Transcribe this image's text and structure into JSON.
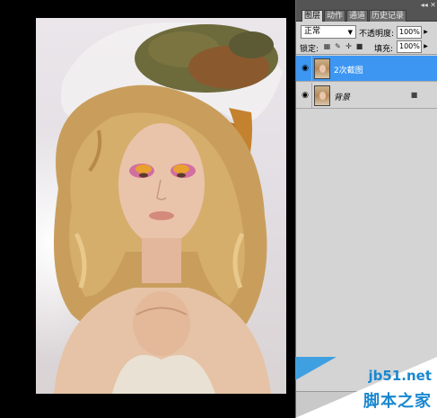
{
  "panel": {
    "tabs": [
      {
        "label": "图层",
        "active": true
      },
      {
        "label": "动作",
        "active": false
      },
      {
        "label": "通道",
        "active": false
      },
      {
        "label": "历史记录",
        "active": false
      }
    ],
    "collapse_label": "◂◂ ✕",
    "blend_mode": "正常",
    "opacity_label": "不透明度:",
    "opacity_value": "100%",
    "lock_label": "锁定:",
    "fill_label": "填充:",
    "fill_value": "100%",
    "layers": [
      {
        "name": "2次截图",
        "selected": true,
        "visible": true,
        "locked": false
      },
      {
        "name": "背景",
        "selected": false,
        "visible": true,
        "locked": true
      }
    ]
  },
  "watermark": {
    "url": "jb51.net",
    "site": "脚本之家"
  },
  "colors": {
    "selection": "#3d97f2",
    "panel_bg": "#d4d4d4",
    "tabbar_bg": "#545454",
    "watermark_blue": "#1a87cf"
  },
  "icons": {
    "visibility": "eye-icon",
    "lock_transparency": "checker-lock-icon",
    "lock_pixels": "brush-lock-icon",
    "lock_position": "move-lock-icon",
    "lock_all": "padlock-icon",
    "layer_lock": "padlock-icon"
  }
}
